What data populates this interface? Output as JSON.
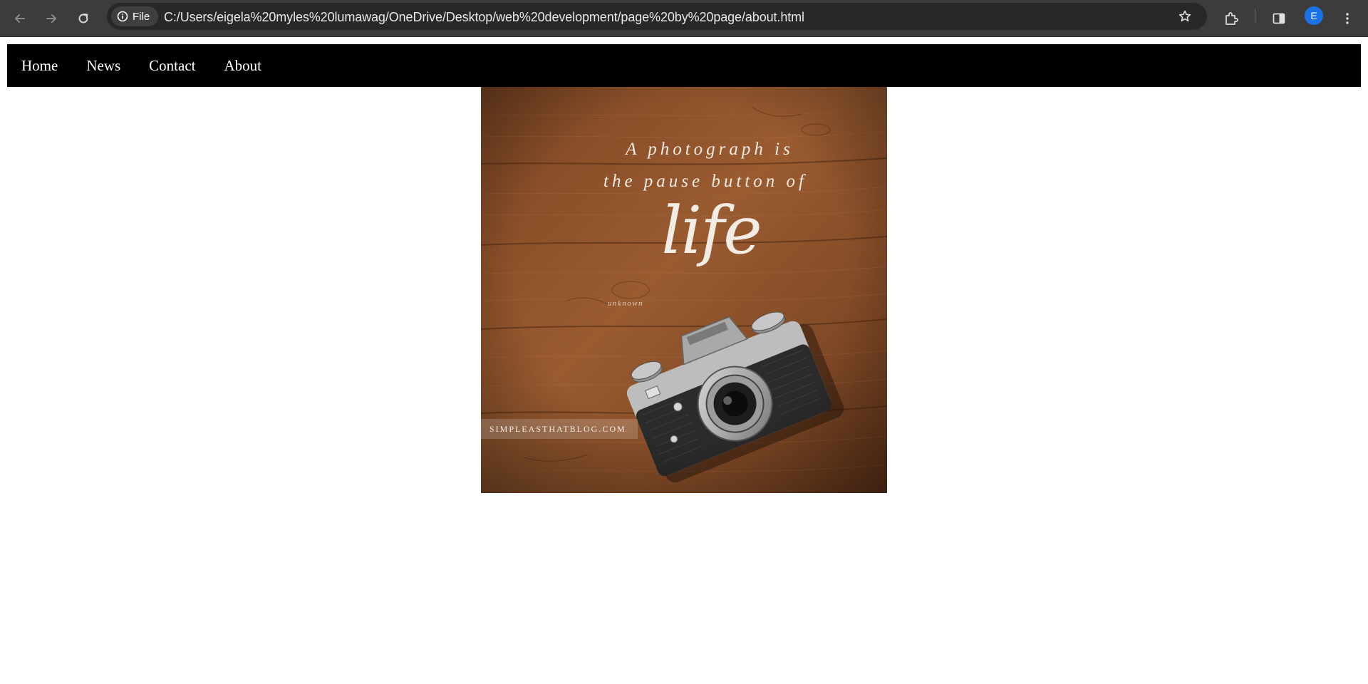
{
  "browser": {
    "address_chip": "File",
    "url": "C:/Users/eigela%20myles%20lumawag/OneDrive/Desktop/web%20development/page%20by%20page/about.html",
    "profile_initial": "E",
    "icons": [
      "back-icon",
      "forward-icon",
      "reload-icon",
      "info-icon",
      "star-icon",
      "extensions-icon",
      "side-panel-icon",
      "kebab-menu-icon"
    ]
  },
  "nav": {
    "items": [
      {
        "label": "Home"
      },
      {
        "label": "News"
      },
      {
        "label": "Contact"
      },
      {
        "label": "About"
      }
    ]
  },
  "image": {
    "quote_line1": "A photograph is",
    "quote_line2": "the pause button of",
    "quote_word": "life",
    "attribution": "unknown",
    "watermark": "SIMPLEASTHATBLOG.COM",
    "colors": {
      "wood": "#8a4f2a",
      "wood_dark": "#5a2f17",
      "text": "#f3ece4"
    }
  }
}
